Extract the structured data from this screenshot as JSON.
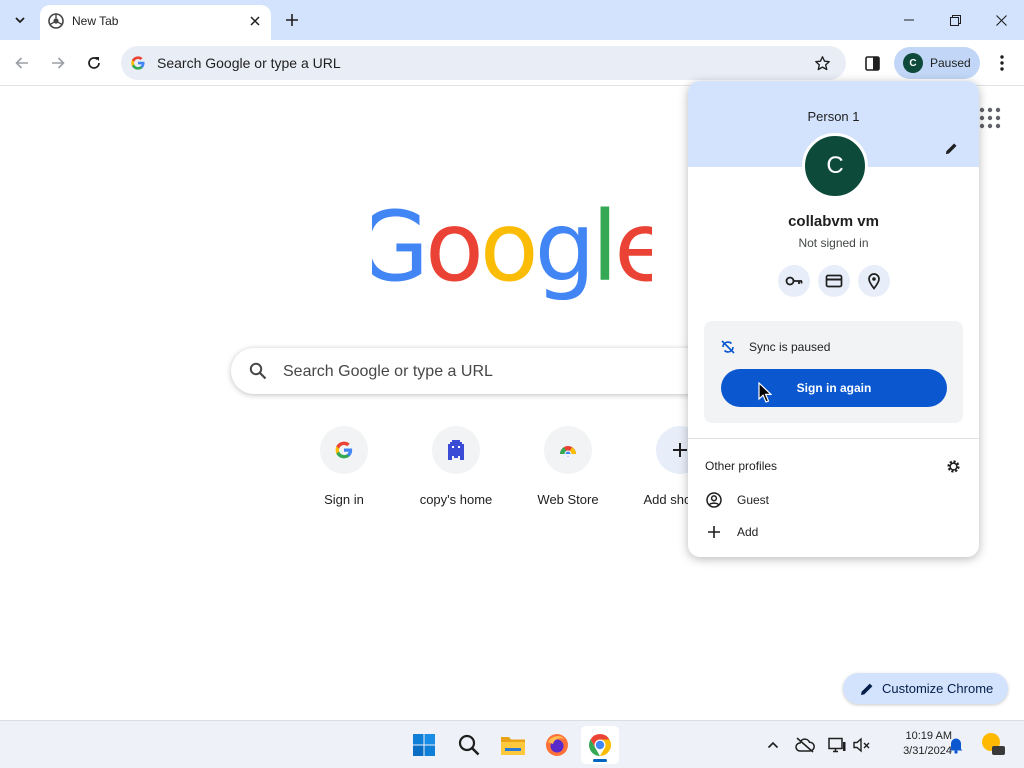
{
  "browser": {
    "tab": {
      "title": "New Tab"
    },
    "omnibox": {
      "placeholder": "Search Google or type a URL"
    },
    "profile_chip": {
      "initial": "C",
      "label": "Paused"
    }
  },
  "ntp": {
    "logo_text": "Google",
    "search_placeholder": "Search Google or type a URL",
    "shortcuts": [
      {
        "label": "Sign in",
        "icon": "google-g-icon"
      },
      {
        "label": "copy's home",
        "icon": "pixel-creature-icon"
      },
      {
        "label": "Web Store",
        "icon": "chrome-web-store-icon"
      },
      {
        "label": "Add shortcut",
        "icon": "plus-icon"
      }
    ],
    "customize_label": "Customize Chrome"
  },
  "profile_popup": {
    "title": "Person 1",
    "avatar_initial": "C",
    "name": "collabvm vm",
    "status": "Not signed in",
    "quick_actions": [
      "key-icon",
      "credit-card-icon",
      "location-pin-icon"
    ],
    "sync_text": "Sync is paused",
    "sign_in_label": "Sign in again",
    "other_profiles_title": "Other profiles",
    "guest_label": "Guest",
    "add_label": "Add"
  },
  "taskbar": {
    "apps": [
      "windows-start-icon",
      "search-icon",
      "file-explorer-icon",
      "firefox-icon",
      "chrome-icon"
    ],
    "time": "10:19 AM",
    "date": "3/31/2024"
  },
  "colors": {
    "tabstrip": "#d3e3fd",
    "accent_blue": "#0b57d0",
    "avatar_green": "#0e4a3a",
    "google_blue": "#4285f4",
    "google_red": "#ea4335",
    "google_yellow": "#fbbc05",
    "google_green": "#34a853"
  }
}
